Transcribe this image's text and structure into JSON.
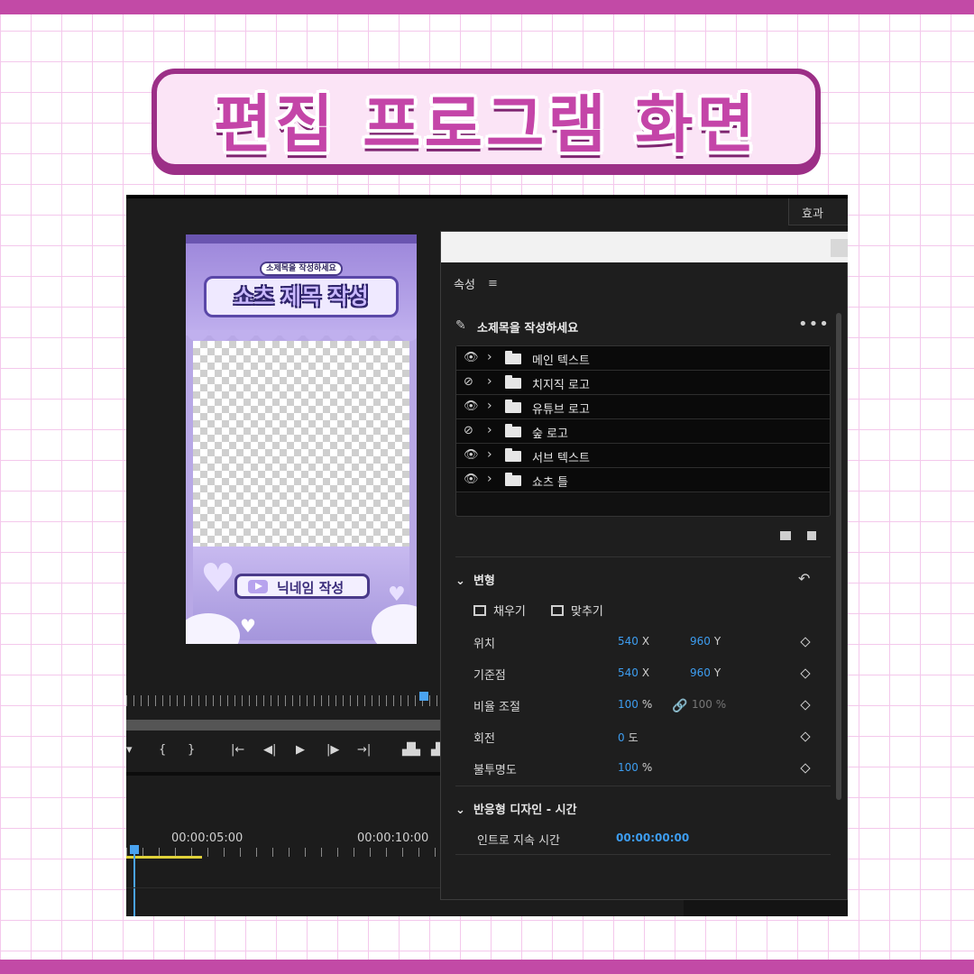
{
  "banner": {
    "title": "편집 프로그램 화면"
  },
  "app": {
    "effects_tab": "효과",
    "preview": {
      "subtitle": "소제목을 작성하세요",
      "title": "쇼츠 제목 작성",
      "nickname": "닉네임 작성"
    },
    "controls": [
      "{",
      "}",
      "|←",
      "◀|",
      "▶",
      "|▶",
      "→|"
    ],
    "timeline": {
      "times": [
        "00:00:05:00",
        "00:00:10:00"
      ]
    },
    "properties": {
      "header": "속성",
      "menu_icon": "menu-icon",
      "graphic_name": "소제목을 작성하세요",
      "more": "•••",
      "layers": [
        {
          "name": "메인 텍스트",
          "visible": true
        },
        {
          "name": "치지직 로고",
          "visible": false
        },
        {
          "name": "유튜브 로고",
          "visible": true
        },
        {
          "name": "숲 로고",
          "visible": false
        },
        {
          "name": "서브 텍스트",
          "visible": true
        },
        {
          "name": "쇼츠 틀",
          "visible": true
        }
      ],
      "transform": {
        "title": "변형",
        "fill_label": "채우기",
        "fit_label": "맞추기",
        "rows": [
          {
            "label": "위치",
            "v1": "540",
            "u1": "X",
            "v2": "960",
            "u2": "Y"
          },
          {
            "label": "기준점",
            "v1": "540",
            "u1": "X",
            "v2": "960",
            "u2": "Y"
          },
          {
            "label": "비율 조절",
            "v1": "100",
            "u1": "%",
            "v2": "100 %",
            "u2": ""
          },
          {
            "label": "회전",
            "v1": "0",
            "u1": "도",
            "v2": "",
            "u2": ""
          },
          {
            "label": "불투명도",
            "v1": "100",
            "u1": "%",
            "v2": "",
            "u2": ""
          }
        ]
      },
      "responsive": {
        "title": "반응형 디자인 - 시간",
        "intro_label": "인트로 지속 시간",
        "intro_value": "00:00:00:00"
      }
    }
  },
  "colors": {
    "accent": "#3d9df0",
    "banner_text": "#c445a8",
    "banner_border": "#9c2f87"
  }
}
